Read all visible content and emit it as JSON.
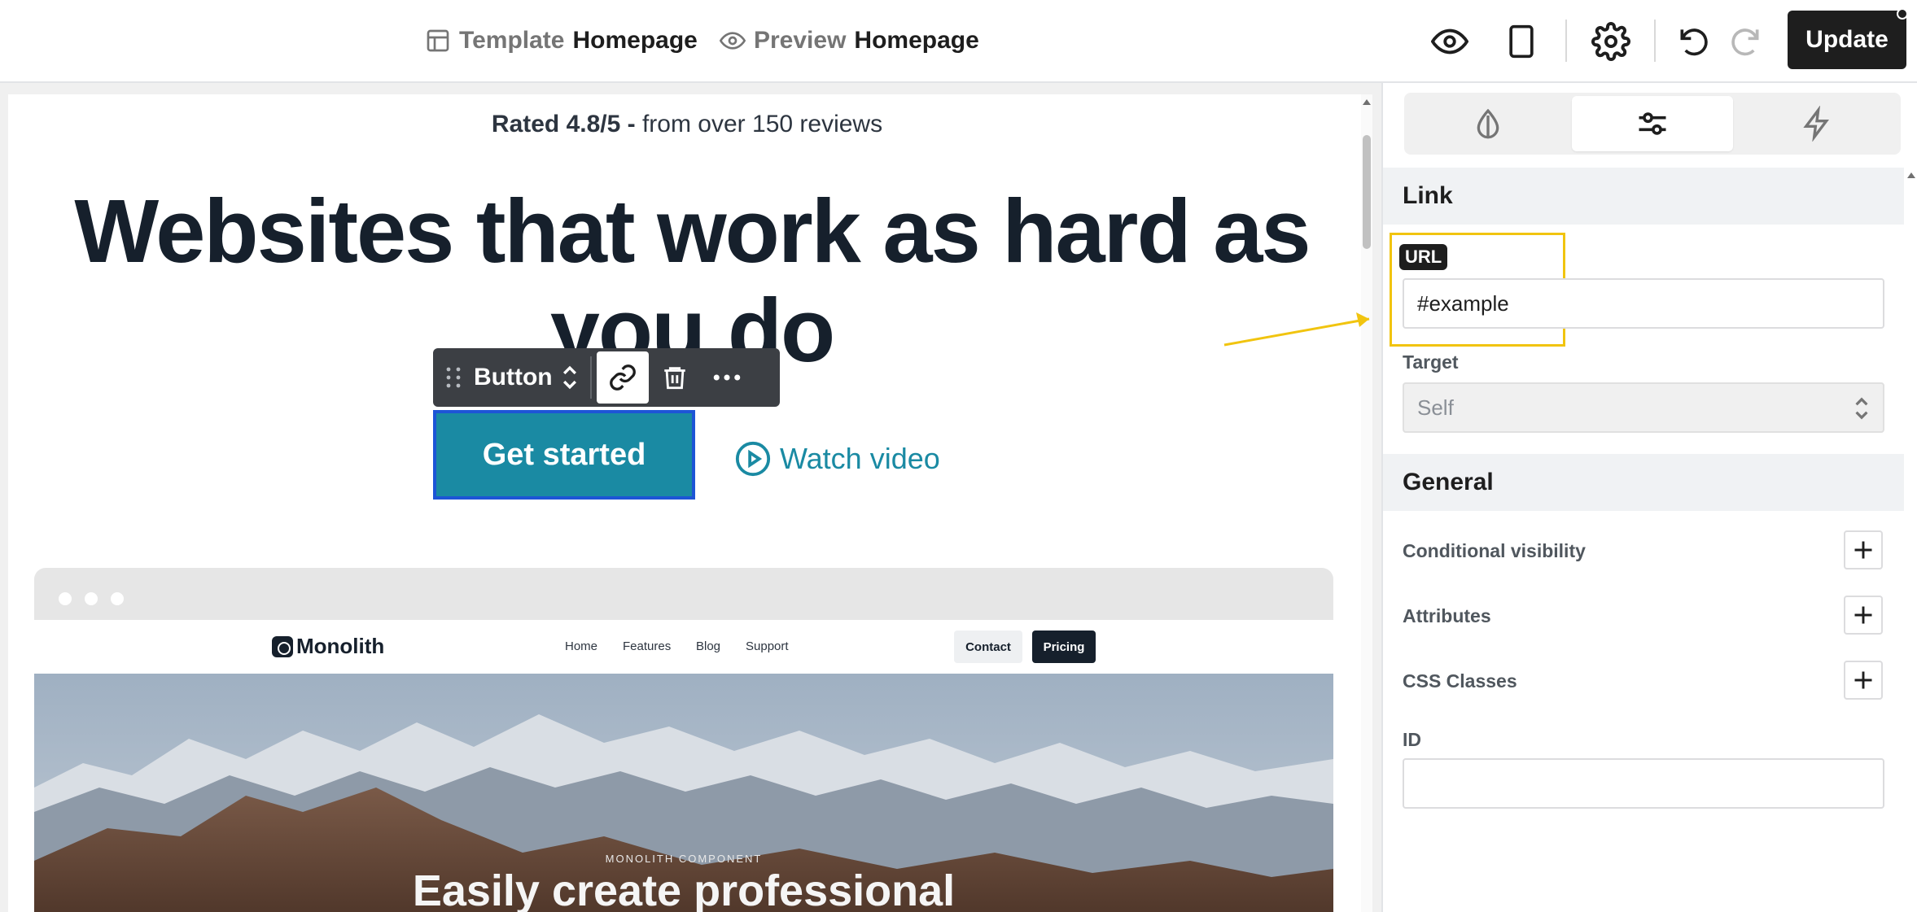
{
  "topbar": {
    "template_prefix": "Template",
    "template_name": "Homepage",
    "preview_prefix": "Preview",
    "preview_name": "Homepage",
    "update_label": "Update",
    "icons": [
      "template-icon",
      "eye-icon",
      "preview-eye-icon",
      "device-icon",
      "gear-icon",
      "undo-icon",
      "redo-icon"
    ]
  },
  "canvas": {
    "rating_bold": "Rated 4.8/5 -",
    "rating_text": " from over 150 reviews",
    "hero_title": "Websites that work as hard as you do",
    "block_toolbar": {
      "block_name": "Button"
    },
    "primary_button": "Get started",
    "secondary_button": "Watch video",
    "mockup": {
      "logo": "Monolith",
      "nav": [
        "Home",
        "Features",
        "Blog",
        "Support"
      ],
      "contact": "Contact",
      "pricing": "Pricing",
      "eyebrow": "MONOLITH COMPONENT",
      "headline": "Easily create professional"
    }
  },
  "sidebar": {
    "tabs": [
      "style-tab",
      "settings-tab",
      "interactions-tab"
    ],
    "link_section": "Link",
    "url_badge": "URL",
    "url_value": "#example",
    "target_label": "Target",
    "target_value": "Self",
    "general_section": "General",
    "rows": [
      "Conditional visibility",
      "Attributes",
      "CSS Classes"
    ],
    "id_label": "ID",
    "id_value": ""
  },
  "colors": {
    "accent": "#1a8aa3",
    "selection": "#1d55d6",
    "highlight": "#f1c40f",
    "dark": "#1e1e1e"
  }
}
